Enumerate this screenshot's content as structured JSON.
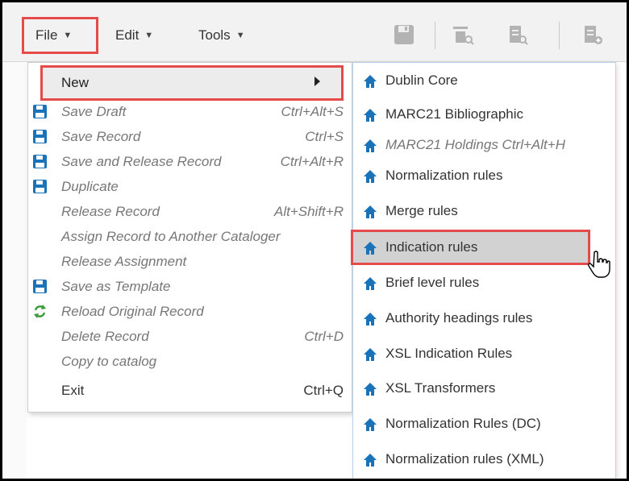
{
  "menubar": {
    "file": "File",
    "edit": "Edit",
    "tools": "Tools",
    "caret": "▼"
  },
  "toolbar_icons": [
    "save-icon",
    "search-record-icon",
    "search-document-icon",
    "add-document-icon"
  ],
  "file_menu": {
    "new": "New",
    "items": [
      {
        "label": "Save Draft",
        "shortcut": "Ctrl+Alt+S",
        "icon": "save-icon"
      },
      {
        "label": "Save Record",
        "shortcut": "Ctrl+S",
        "icon": "save-icon"
      },
      {
        "label": "Save and Release Record",
        "shortcut": "Ctrl+Alt+R",
        "icon": "save-icon"
      },
      {
        "label": "Duplicate",
        "shortcut": "",
        "icon": "save-icon"
      },
      {
        "label": "Release Record",
        "shortcut": "Alt+Shift+R",
        "icon": ""
      },
      {
        "label": "Assign Record to Another Cataloger",
        "shortcut": "",
        "icon": ""
      },
      {
        "label": "Release Assignment",
        "shortcut": "",
        "icon": ""
      },
      {
        "label": "Save as Template",
        "shortcut": "",
        "icon": "save-icon"
      },
      {
        "label": "Reload Original Record",
        "shortcut": "",
        "icon": "reload-icon"
      },
      {
        "label": "Delete Record",
        "shortcut": "Ctrl+D",
        "icon": ""
      },
      {
        "label": "Copy to catalog",
        "shortcut": "",
        "icon": ""
      }
    ],
    "exit": {
      "label": "Exit",
      "shortcut": "Ctrl+Q"
    }
  },
  "submenu": {
    "items": [
      {
        "label": "Dublin Core",
        "disabled": false
      },
      {
        "label": "MARC21 Bibliographic",
        "disabled": false
      },
      {
        "label": "MARC21 Holdings   Ctrl+Alt+H",
        "disabled": true
      },
      {
        "label": "Normalization rules",
        "disabled": false
      },
      {
        "label": "Merge rules",
        "disabled": false
      },
      {
        "label": "Indication rules",
        "disabled": false,
        "selected": true
      },
      {
        "label": "Brief level rules",
        "disabled": false
      },
      {
        "label": "Authority headings rules",
        "disabled": false
      },
      {
        "label": "XSL Indication Rules",
        "disabled": false
      },
      {
        "label": "XSL Transformers",
        "disabled": false
      },
      {
        "label": "Normalization Rules (DC)",
        "disabled": false
      },
      {
        "label": "Normalization rules (XML)",
        "disabled": false
      }
    ]
  },
  "colors": {
    "highlight": "#e54b4b",
    "icon_blue": "#1a73b8",
    "reload_green": "#3a9a3a"
  }
}
